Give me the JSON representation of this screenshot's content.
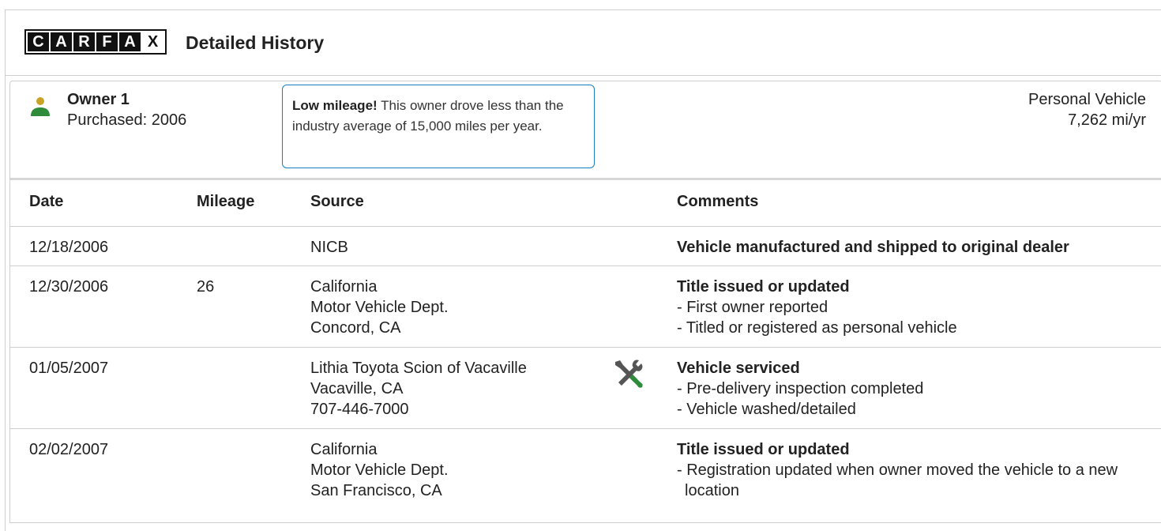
{
  "header": {
    "title": "Detailed History",
    "logo_letters": [
      "C",
      "A",
      "R",
      "F",
      "A",
      "X"
    ]
  },
  "owner": {
    "name": "Owner 1",
    "purchased": "Purchased: 2006",
    "vehicle_type": "Personal Vehicle",
    "mileage_per_year": "7,262 mi/yr"
  },
  "note": {
    "bold": "Low mileage!",
    "text": " This owner drove less than the industry average of 15,000 miles per year."
  },
  "table": {
    "columns": [
      "Date",
      "Mileage",
      "Source",
      "Comments"
    ],
    "rows": [
      {
        "date": "12/18/2006",
        "mileage": "",
        "source": [
          "NICB"
        ],
        "comment_title": "Vehicle manufactured and shipped to original dealer",
        "comment_items": []
      },
      {
        "date": "12/30/2006",
        "mileage": "26",
        "source": [
          "California",
          "Motor Vehicle Dept.",
          "Concord, CA"
        ],
        "comment_title": "Title issued or updated",
        "comment_items": [
          "- First owner reported",
          "- Titled or registered as personal vehicle"
        ]
      },
      {
        "date": "01/05/2007",
        "mileage": "",
        "source": [
          "Lithia Toyota Scion of Vacaville",
          "Vacaville, CA",
          "707-446-7000"
        ],
        "icon": "service-wrench-icon",
        "comment_title": "Vehicle serviced",
        "comment_items": [
          "- Pre-delivery inspection completed",
          "- Vehicle washed/detailed"
        ]
      },
      {
        "date": "02/02/2007",
        "mileage": "",
        "source": [
          "California",
          "Motor Vehicle Dept.",
          "San Francisco, CA"
        ],
        "comment_title": "Title issued or updated",
        "comment_items": [
          "- Registration updated when owner moved the vehicle to a new location"
        ]
      }
    ]
  },
  "colors": {
    "accent_blue": "#1a7fc1",
    "owner_head": "#c9a227",
    "owner_body": "#2e8b3a",
    "wrench_green": "#2e8b3a",
    "wrench_gray": "#555555"
  }
}
